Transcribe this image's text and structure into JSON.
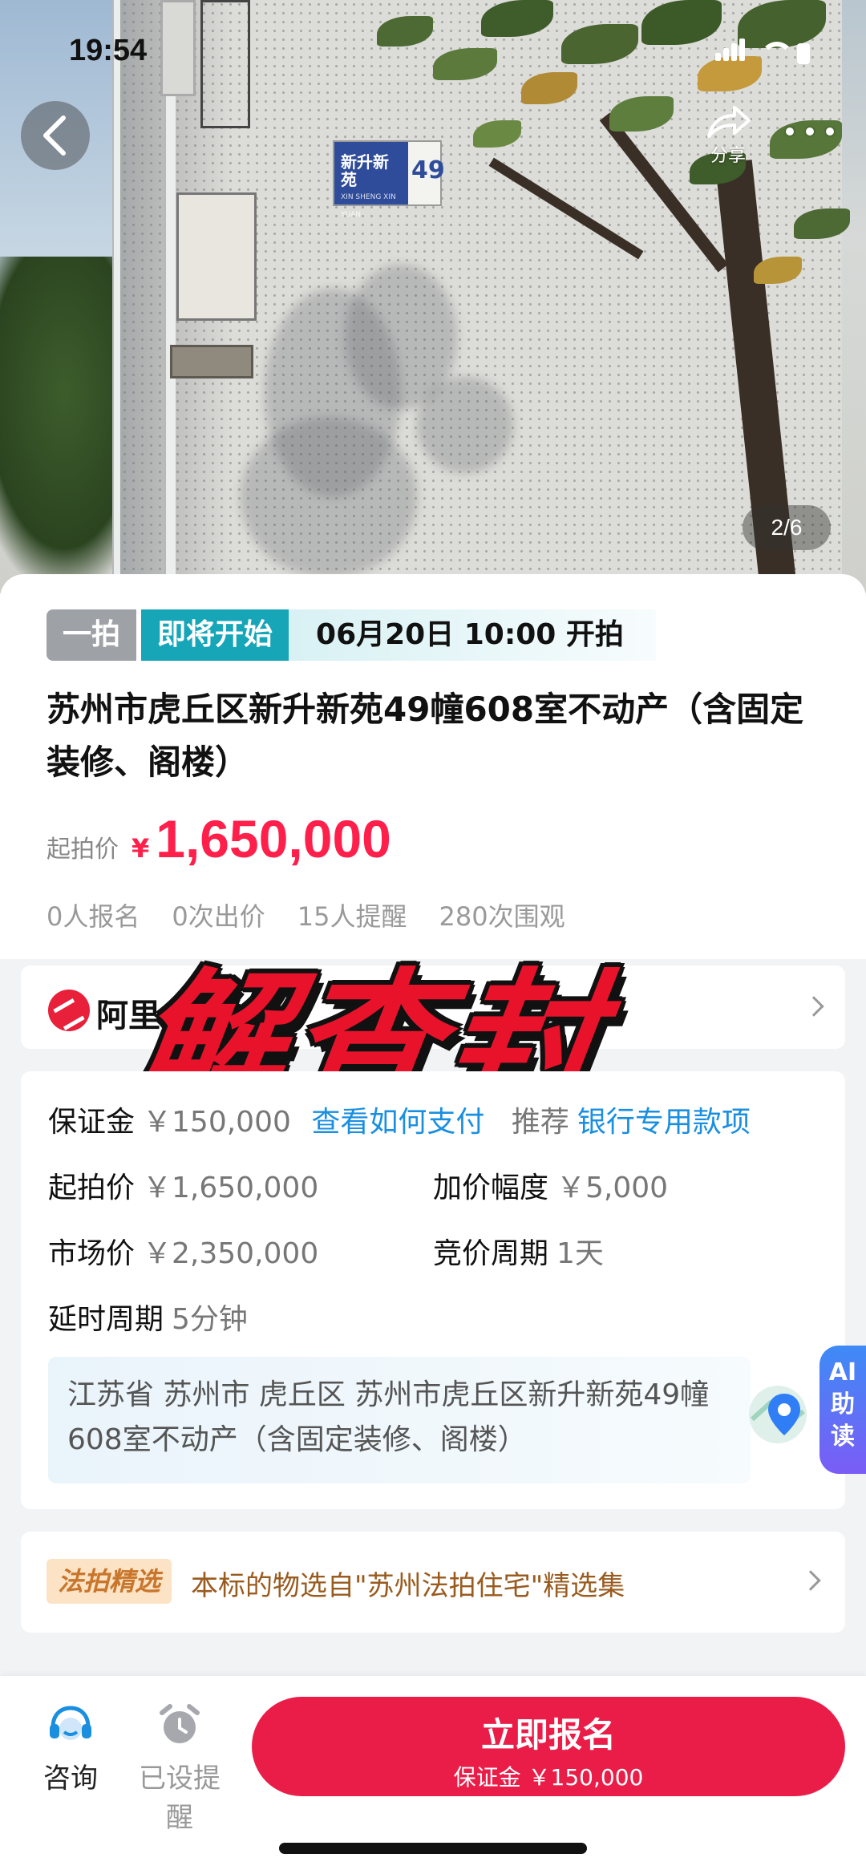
{
  "status_bar": {
    "time": "19:54"
  },
  "gallery": {
    "counter": "2/6",
    "share_label": "分享"
  },
  "auction": {
    "round_tag": "一拍",
    "status_tag": "即将开始",
    "start_time": "06月20日 10:00 开拍",
    "title": "苏州市虎丘区新升新苑49幢608室不动产（含固定装修、阁楼）",
    "start_price_label": "起拍价",
    "currency_symbol": "¥",
    "start_price": "1,650,000",
    "stats": [
      "0人报名",
      "0次出价",
      "15人提醒",
      "280次围观"
    ]
  },
  "platform_row": {
    "label": "阿里"
  },
  "overlay_text": "解查封",
  "details": {
    "deposit_label": "保证金",
    "deposit_value": "￥150,000",
    "deposit_link": "查看如何支付",
    "recommend_label": "推荐",
    "recommend_link": "银行专用款项",
    "start_price_label": "起拍价",
    "start_price_value": "￥1,650,000",
    "increment_label": "加价幅度",
    "increment_value": "￥5,000",
    "market_price_label": "市场价",
    "market_price_value": "￥2,350,000",
    "bid_cycle_label": "竞价周期",
    "bid_cycle_value": "1天",
    "delay_label": "延时周期",
    "delay_value": "5分钟",
    "address": "江苏省 苏州市 虎丘区 苏州市虎丘区新升新苑49幢608室不动产（含固定装修、阁楼）"
  },
  "ai_tab": {
    "line1": "AI",
    "line2": "助",
    "line3": "读"
  },
  "featured": {
    "tag": "法拍精选",
    "text": "本标的物选自\"苏州法拍住宅\"精选集"
  },
  "bottom_bar": {
    "consult_label": "咨询",
    "reminder_label": "已设提醒",
    "cta_label": "立即报名",
    "cta_sub": "保证金 ￥150,000"
  },
  "colors": {
    "price_red": "#ff1f4b",
    "status_teal": "#17a6b8",
    "link_blue": "#1a8fe0",
    "cta_red": "#ea1d48"
  }
}
